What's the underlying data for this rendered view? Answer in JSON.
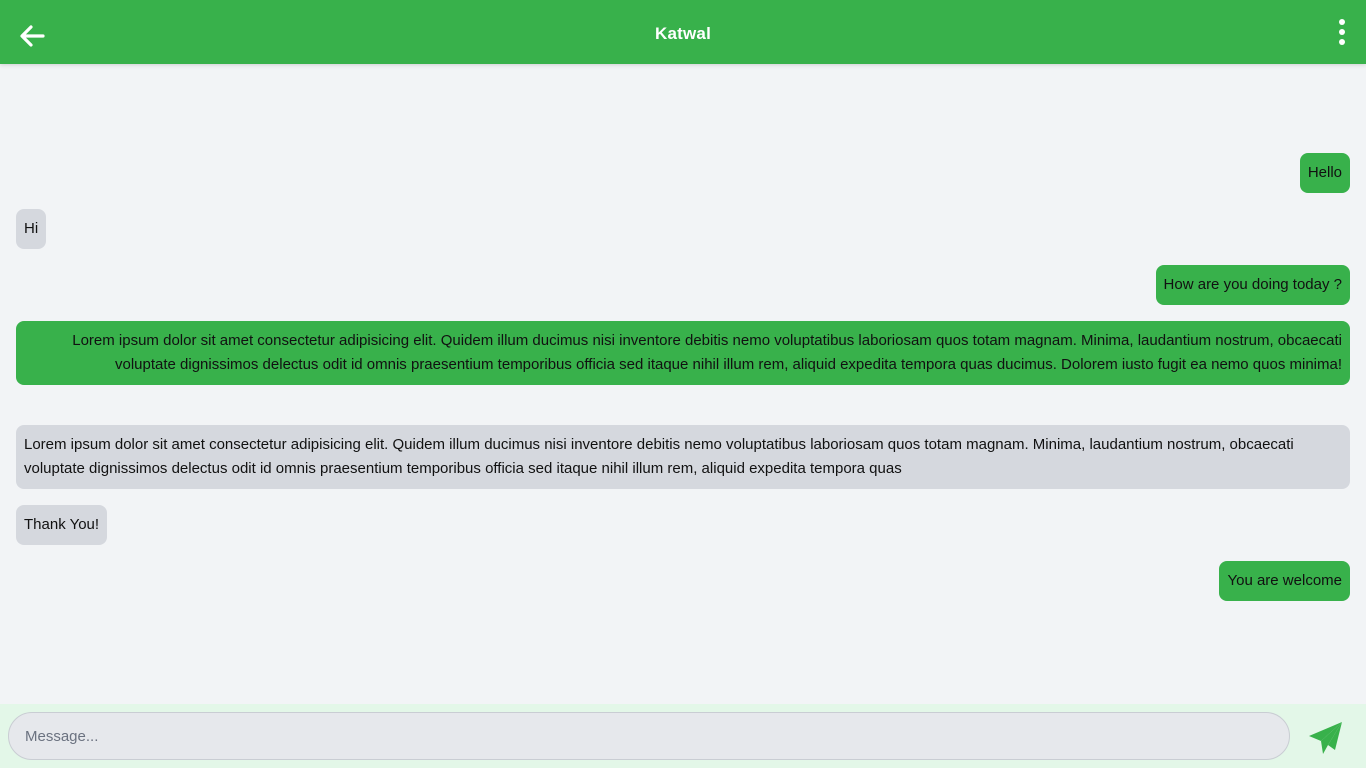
{
  "header": {
    "title": "Katwal",
    "back_icon": "arrow-left-icon",
    "menu_icon": "vertical-dots-icon"
  },
  "colors": {
    "accent": "#38b14b",
    "sent_bubble": "#38b14b",
    "received_bubble": "#d5d8de",
    "background": "#f2f4f6",
    "composer_background": "#e3f7e8"
  },
  "messages": [
    {
      "direction": "sent",
      "text": "Hello"
    },
    {
      "direction": "received",
      "text": "Hi"
    },
    {
      "direction": "sent",
      "text": "How are you doing today ?"
    },
    {
      "direction": "sent",
      "text": "Lorem ipsum dolor sit amet consectetur adipisicing elit. Quidem illum ducimus nisi inventore debitis nemo voluptatibus laboriosam quos totam magnam. Minima, laudantium nostrum, obcaecati voluptate dignissimos delectus odit id omnis praesentium temporibus officia sed itaque nihil illum rem, aliquid expedita tempora quas ducimus. Dolorem iusto fugit ea nemo quos minima!"
    },
    {
      "direction": "received",
      "text": "Lorem ipsum dolor sit amet consectetur adipisicing elit. Quidem illum ducimus nisi inventore debitis nemo voluptatibus laboriosam quos totam magnam. Minima, laudantium nostrum, obcaecati voluptate dignissimos delectus odit id omnis praesentium temporibus officia sed itaque nihil illum rem, aliquid expedita tempora quas"
    },
    {
      "direction": "received",
      "text": "Thank You!"
    },
    {
      "direction": "sent",
      "text": "You are welcome"
    }
  ],
  "composer": {
    "placeholder": "Message...",
    "value": "",
    "send_icon": "send-icon"
  }
}
